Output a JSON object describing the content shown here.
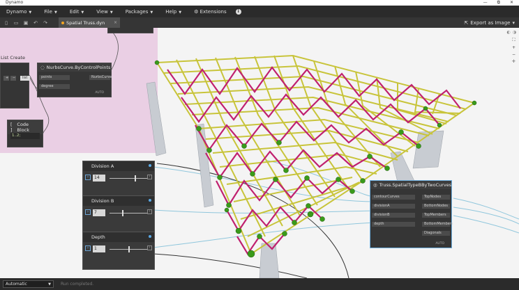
{
  "window": {
    "title": "Dynamo",
    "minimize": "—",
    "maximize": "⧉",
    "close": "✕"
  },
  "menu": {
    "items": [
      {
        "label": "Dynamo"
      },
      {
        "label": "File"
      },
      {
        "label": "Edit"
      },
      {
        "label": "View"
      },
      {
        "label": "Packages"
      },
      {
        "label": "Help"
      }
    ],
    "extensions": "Extensions"
  },
  "toolbar": {
    "tab_title": "Spatial Truss.dyn",
    "tab_close": "×",
    "export_label": "Export as Image",
    "export_caret": "▾"
  },
  "nodes": {
    "list_create": {
      "title": "List Create",
      "btn_add": "+",
      "btn_remove": "−",
      "port": "list"
    },
    "nurbs": {
      "title": "NurbsCurve.ByControlPoints",
      "inputs": [
        "points",
        "degree"
      ],
      "output": "NurbsCurve",
      "lacing": "AUTO"
    },
    "code_block": {
      "title": "Code Block",
      "code": "1..2;"
    },
    "truss": {
      "title": "Truss.SpatialTypeBByTwoCurves",
      "inputs": [
        "contourCurves",
        "divisionA",
        "divisionB",
        "depth"
      ],
      "outputs": [
        "TopNodes",
        "BottomNodes",
        "TopMembers",
        "BottomMembers",
        "Diagonals"
      ],
      "lacing": "AUTO"
    }
  },
  "sliders": [
    {
      "label": "Division A",
      "value": "14",
      "level": 0.67
    },
    {
      "label": "Division B",
      "value": "7",
      "level": 0.33
    },
    {
      "label": "Depth",
      "value": "1",
      "level": 0.5
    }
  ],
  "statusbar": {
    "run_mode": "Automatic",
    "run_status": "Run completed."
  },
  "colors": {
    "top_chord": "#c8c43a",
    "diagonal": "#c0206f",
    "node_sphere": "#3a9a1a",
    "column": "#c8ccd2",
    "group": "#e7c8e0"
  }
}
